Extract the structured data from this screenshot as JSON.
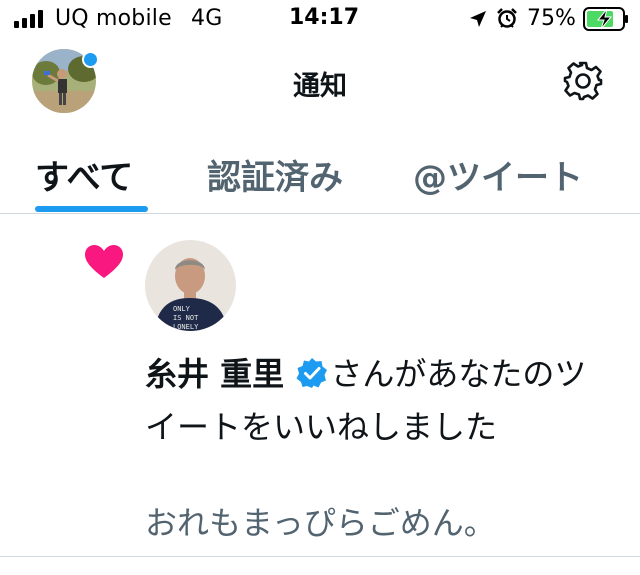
{
  "status_bar": {
    "carrier": "UQ mobile",
    "network": "4G",
    "time": "14:17",
    "battery_percent": "75%",
    "signal_bars": 4,
    "icons": [
      "signal-icon",
      "location-icon",
      "alarm-icon",
      "battery-charging-icon"
    ]
  },
  "header": {
    "title": "通知",
    "settings_icon": "gear-icon",
    "avatar_has_badge": true
  },
  "tabs": [
    {
      "label": "すべて",
      "active": true
    },
    {
      "label": "認証済み",
      "active": false
    },
    {
      "label": "@ツイート",
      "active": false
    }
  ],
  "notification": {
    "type_icon": "heart-icon",
    "user_name": "糸井 重里",
    "verified": true,
    "action_text": "さんがあなたのツイートをいいねしました",
    "tweet_text": "おれもまっぴらごめん。"
  },
  "colors": {
    "accent": "#1d9bf0",
    "like": "#f91880",
    "text_primary": "#0f1419",
    "text_secondary": "#536471",
    "divider": "#cfd9de"
  }
}
